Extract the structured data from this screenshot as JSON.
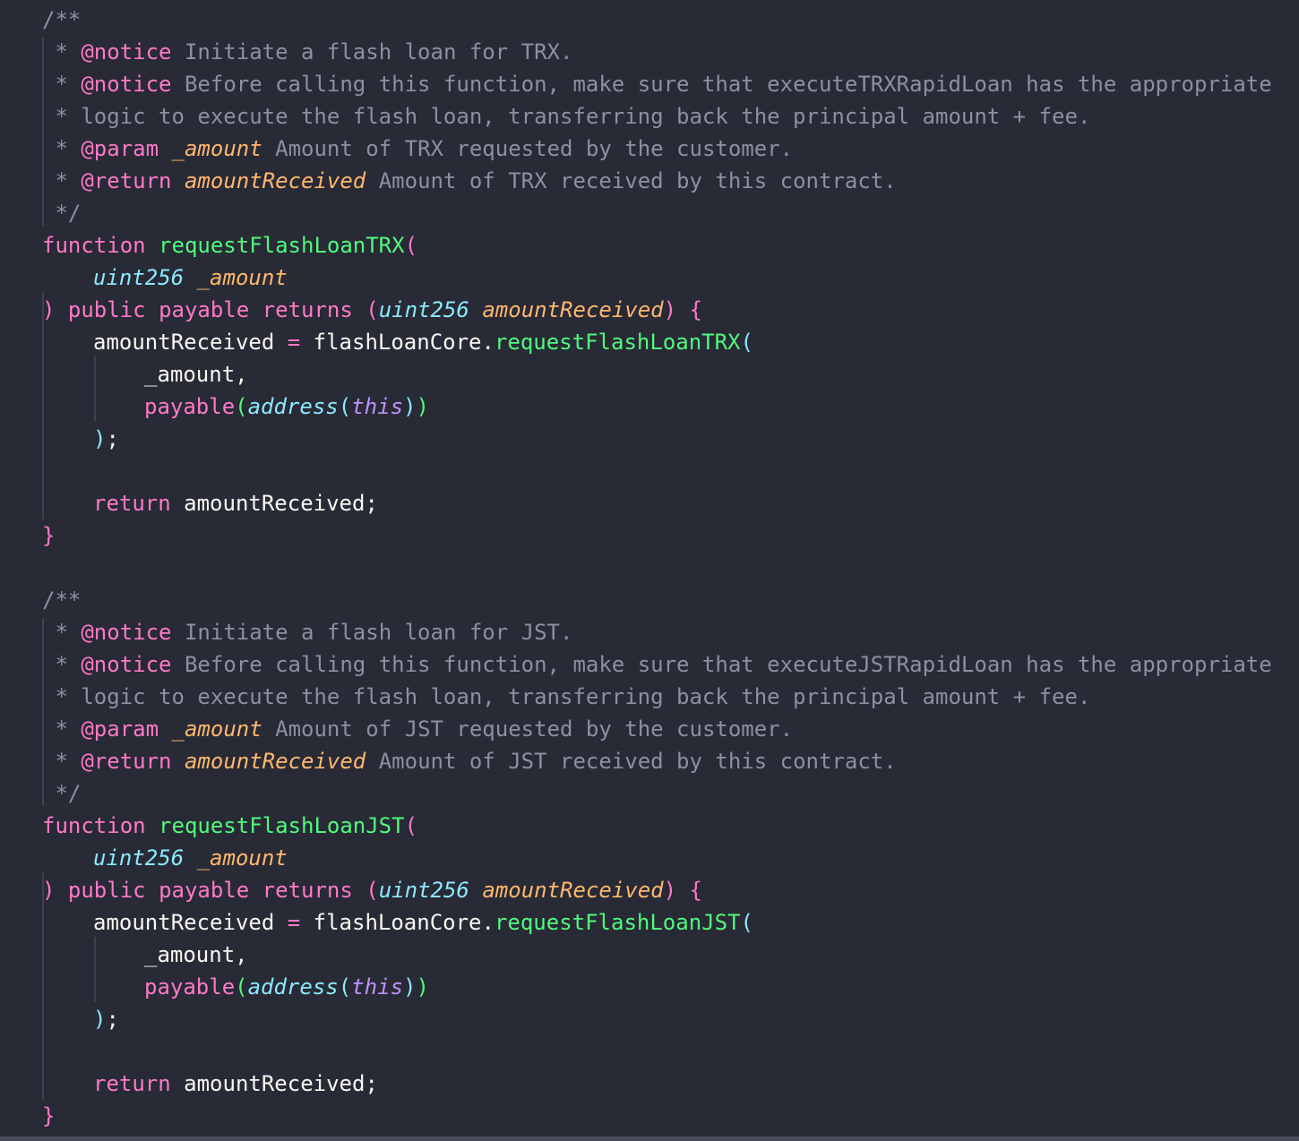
{
  "editor": {
    "theme_colors": {
      "background": "#282a36",
      "comment": "#8d8fa3",
      "keyword": "#ff79c6",
      "function": "#50fa7b",
      "type": "#8be9fd",
      "parameter": "#ffb86c",
      "this": "#bd93f9",
      "plain": "#f8f8f2"
    },
    "lines": [
      {
        "indent": 0,
        "tokens": [
          {
            "t": "/**",
            "c": "cm"
          }
        ]
      },
      {
        "indent": 0,
        "tokens": [
          {
            "t": " * ",
            "c": "cm"
          },
          {
            "t": "@notice",
            "c": "tag"
          },
          {
            "t": " Initiate a flash loan for TRX.",
            "c": "cm"
          }
        ]
      },
      {
        "indent": 0,
        "tokens": [
          {
            "t": " * ",
            "c": "cm"
          },
          {
            "t": "@notice",
            "c": "tag"
          },
          {
            "t": " Before calling this function, make sure that executeTRXRapidLoan has the appropriate",
            "c": "cm"
          }
        ]
      },
      {
        "indent": 0,
        "tokens": [
          {
            "t": " * logic to execute the flash loan, transferring back the principal amount + fee.",
            "c": "cm"
          }
        ]
      },
      {
        "indent": 0,
        "tokens": [
          {
            "t": " * ",
            "c": "cm"
          },
          {
            "t": "@param",
            "c": "tag"
          },
          {
            "t": " ",
            "c": "cm"
          },
          {
            "t": "_amount",
            "c": "prm"
          },
          {
            "t": " Amount of TRX requested by the customer.",
            "c": "cm"
          }
        ]
      },
      {
        "indent": 0,
        "tokens": [
          {
            "t": " * ",
            "c": "cm"
          },
          {
            "t": "@return",
            "c": "tag"
          },
          {
            "t": " ",
            "c": "cm"
          },
          {
            "t": "amountReceived",
            "c": "prm"
          },
          {
            "t": " Amount of TRX received by this contract.",
            "c": "cm"
          }
        ]
      },
      {
        "indent": 0,
        "tokens": [
          {
            "t": " */",
            "c": "cm"
          }
        ]
      },
      {
        "indent": 0,
        "tokens": [
          {
            "t": "function",
            "c": "kw"
          },
          {
            "t": " ",
            "c": "pl"
          },
          {
            "t": "requestFlashLoanTRX",
            "c": "fn"
          },
          {
            "t": "(",
            "c": "kw"
          }
        ]
      },
      {
        "indent": 1,
        "tokens": [
          {
            "t": "uint256",
            "c": "ty"
          },
          {
            "t": " ",
            "c": "pl"
          },
          {
            "t": "_amount",
            "c": "pv"
          }
        ]
      },
      {
        "indent": 0,
        "tokens": [
          {
            "t": ") ",
            "c": "kw"
          },
          {
            "t": "public",
            "c": "kw"
          },
          {
            "t": " ",
            "c": "pl"
          },
          {
            "t": "payable",
            "c": "kw"
          },
          {
            "t": " ",
            "c": "pl"
          },
          {
            "t": "returns",
            "c": "kw"
          },
          {
            "t": " (",
            "c": "kw"
          },
          {
            "t": "uint256",
            "c": "ty"
          },
          {
            "t": " ",
            "c": "pl"
          },
          {
            "t": "amountReceived",
            "c": "pv"
          },
          {
            "t": ") {",
            "c": "kw"
          }
        ]
      },
      {
        "indent": 1,
        "tokens": [
          {
            "t": "amountReceived",
            "c": "pl"
          },
          {
            "t": " = ",
            "c": "kw"
          },
          {
            "t": "flashLoanCore.",
            "c": "pl"
          },
          {
            "t": "requestFlashLoanTRX",
            "c": "fn"
          },
          {
            "t": "(",
            "c": "pc"
          }
        ]
      },
      {
        "indent": 2,
        "tokens": [
          {
            "t": "_amount,",
            "c": "pl"
          }
        ]
      },
      {
        "indent": 2,
        "tokens": [
          {
            "t": "payable",
            "c": "kw"
          },
          {
            "t": "(",
            "c": "fn"
          },
          {
            "t": "address",
            "c": "ty"
          },
          {
            "t": "(",
            "c": "pc"
          },
          {
            "t": "this",
            "c": "sp"
          },
          {
            "t": ")",
            "c": "pc"
          },
          {
            "t": ")",
            "c": "fn"
          }
        ]
      },
      {
        "indent": 1,
        "tokens": [
          {
            "t": ")",
            "c": "pc"
          },
          {
            "t": ";",
            "c": "pl"
          }
        ]
      },
      {
        "indent": 0,
        "tokens": []
      },
      {
        "indent": 1,
        "tokens": [
          {
            "t": "return",
            "c": "kw"
          },
          {
            "t": " amountReceived;",
            "c": "pl"
          }
        ]
      },
      {
        "indent": 0,
        "tokens": [
          {
            "t": "}",
            "c": "kw"
          }
        ]
      },
      {
        "indent": 0,
        "tokens": []
      },
      {
        "indent": 0,
        "tokens": [
          {
            "t": "/**",
            "c": "cm"
          }
        ]
      },
      {
        "indent": 0,
        "tokens": [
          {
            "t": " * ",
            "c": "cm"
          },
          {
            "t": "@notice",
            "c": "tag"
          },
          {
            "t": " Initiate a flash loan for JST.",
            "c": "cm"
          }
        ]
      },
      {
        "indent": 0,
        "tokens": [
          {
            "t": " * ",
            "c": "cm"
          },
          {
            "t": "@notice",
            "c": "tag"
          },
          {
            "t": " Before calling this function, make sure that executeJSTRapidLoan has the appropriate",
            "c": "cm"
          }
        ]
      },
      {
        "indent": 0,
        "tokens": [
          {
            "t": " * logic to execute the flash loan, transferring back the principal amount + fee.",
            "c": "cm"
          }
        ]
      },
      {
        "indent": 0,
        "tokens": [
          {
            "t": " * ",
            "c": "cm"
          },
          {
            "t": "@param",
            "c": "tag"
          },
          {
            "t": " ",
            "c": "cm"
          },
          {
            "t": "_amount",
            "c": "prm"
          },
          {
            "t": " Amount of JST requested by the customer.",
            "c": "cm"
          }
        ]
      },
      {
        "indent": 0,
        "tokens": [
          {
            "t": " * ",
            "c": "cm"
          },
          {
            "t": "@return",
            "c": "tag"
          },
          {
            "t": " ",
            "c": "cm"
          },
          {
            "t": "amountReceived",
            "c": "prm"
          },
          {
            "t": " Amount of JST received by this contract.",
            "c": "cm"
          }
        ]
      },
      {
        "indent": 0,
        "tokens": [
          {
            "t": " */",
            "c": "cm"
          }
        ]
      },
      {
        "indent": 0,
        "tokens": [
          {
            "t": "function",
            "c": "kw"
          },
          {
            "t": " ",
            "c": "pl"
          },
          {
            "t": "requestFlashLoanJST",
            "c": "fn"
          },
          {
            "t": "(",
            "c": "kw"
          }
        ]
      },
      {
        "indent": 1,
        "tokens": [
          {
            "t": "uint256",
            "c": "ty"
          },
          {
            "t": " ",
            "c": "pl"
          },
          {
            "t": "_amount",
            "c": "pv"
          }
        ]
      },
      {
        "indent": 0,
        "tokens": [
          {
            "t": ") ",
            "c": "kw"
          },
          {
            "t": "public",
            "c": "kw"
          },
          {
            "t": " ",
            "c": "pl"
          },
          {
            "t": "payable",
            "c": "kw"
          },
          {
            "t": " ",
            "c": "pl"
          },
          {
            "t": "returns",
            "c": "kw"
          },
          {
            "t": " (",
            "c": "kw"
          },
          {
            "t": "uint256",
            "c": "ty"
          },
          {
            "t": " ",
            "c": "pl"
          },
          {
            "t": "amountReceived",
            "c": "pv"
          },
          {
            "t": ") {",
            "c": "kw"
          }
        ]
      },
      {
        "indent": 1,
        "tokens": [
          {
            "t": "amountReceived",
            "c": "pl"
          },
          {
            "t": " = ",
            "c": "kw"
          },
          {
            "t": "flashLoanCore.",
            "c": "pl"
          },
          {
            "t": "requestFlashLoanJST",
            "c": "fn"
          },
          {
            "t": "(",
            "c": "pc"
          }
        ]
      },
      {
        "indent": 2,
        "tokens": [
          {
            "t": "_amount,",
            "c": "pl"
          }
        ]
      },
      {
        "indent": 2,
        "tokens": [
          {
            "t": "payable",
            "c": "kw"
          },
          {
            "t": "(",
            "c": "fn"
          },
          {
            "t": "address",
            "c": "ty"
          },
          {
            "t": "(",
            "c": "pc"
          },
          {
            "t": "this",
            "c": "sp"
          },
          {
            "t": ")",
            "c": "pc"
          },
          {
            "t": ")",
            "c": "fn"
          }
        ]
      },
      {
        "indent": 1,
        "tokens": [
          {
            "t": ")",
            "c": "pc"
          },
          {
            "t": ";",
            "c": "pl"
          }
        ]
      },
      {
        "indent": 0,
        "tokens": []
      },
      {
        "indent": 1,
        "tokens": [
          {
            "t": "return",
            "c": "kw"
          },
          {
            "t": " amountReceived;",
            "c": "pl"
          }
        ]
      },
      {
        "indent": 0,
        "tokens": [
          {
            "t": "}",
            "c": "kw"
          }
        ]
      }
    ]
  }
}
